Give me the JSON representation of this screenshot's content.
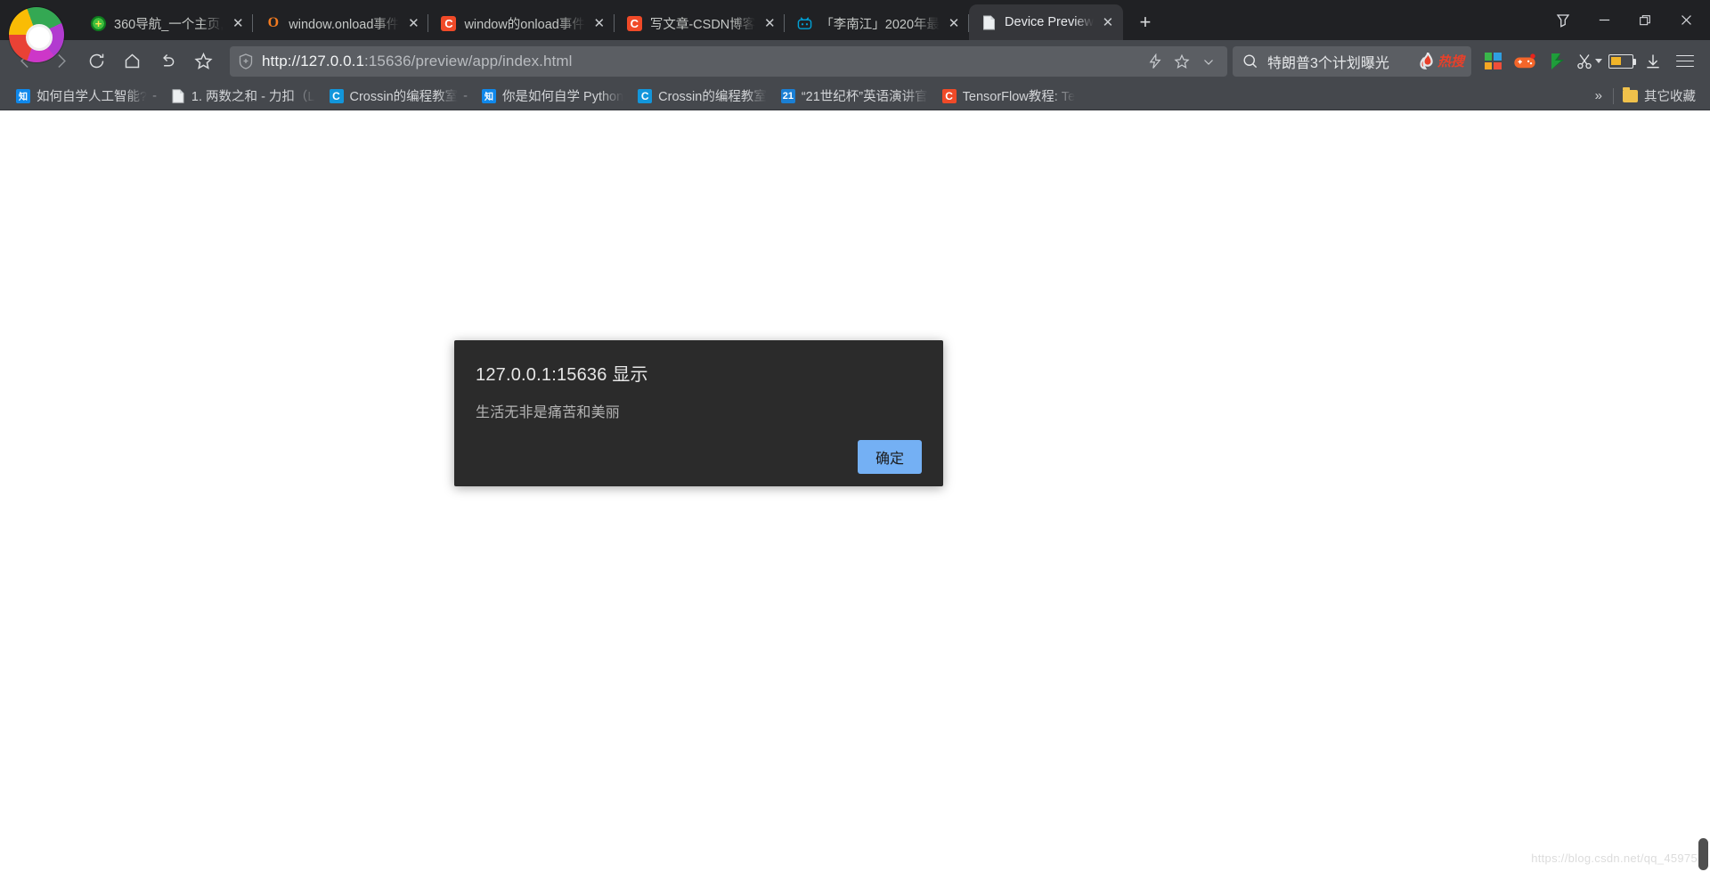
{
  "window": {
    "controls": {
      "tab_search": "tab-search",
      "minimize": "—",
      "maximize": "▢",
      "close": "✕"
    },
    "new_tab_label": "+"
  },
  "tabs": [
    {
      "title": "360导航_一个主页,",
      "favicon": "360-icon",
      "active": false,
      "close": "✕"
    },
    {
      "title": "window.onload事件",
      "favicon": "opera-o-icon",
      "active": false,
      "close": "✕"
    },
    {
      "title": "window的onload事件",
      "favicon": "csdn-icon",
      "active": false,
      "close": "✕"
    },
    {
      "title": "写文章-CSDN博客",
      "favicon": "csdn-icon",
      "active": false,
      "close": "✕"
    },
    {
      "title": "「李南江」2020年最",
      "favicon": "bilibili-icon",
      "active": false,
      "close": "✕"
    },
    {
      "title": "Device Preview",
      "favicon": "page-icon",
      "active": true,
      "close": "✕"
    }
  ],
  "toolbar": {
    "back": "back-arrow-icon",
    "forward": "forward-arrow-icon",
    "reload": "reload-icon",
    "home": "home-icon",
    "undo": "undo-icon",
    "bookmark_star": "star-icon",
    "omnibox": {
      "security_icon": "shield-icon",
      "url_host": "http://127.0.0.1",
      "url_rest": ":15636/preview/app/index.html",
      "url_full": "http://127.0.0.1:15636/preview/app/index.html",
      "flash_icon": "lightning-icon",
      "star_icon": "star-outline-icon",
      "chevron_icon": "chevron-down-icon"
    },
    "search": {
      "icon": "search-icon",
      "query": "特朗普3个计划曝光",
      "badge": "热搜"
    },
    "extensions": [
      {
        "name": "microsoft-grid-icon"
      },
      {
        "name": "gamepad-icon"
      },
      {
        "name": "leaf-icon"
      },
      {
        "name": "scissors-icon"
      },
      {
        "name": "battery-icon"
      },
      {
        "name": "download-icon"
      },
      {
        "name": "menu-icon"
      }
    ]
  },
  "bookmarks": {
    "items": [
      {
        "label": "如何自学人工智能?",
        "favicon": "zhihu-icon",
        "fav_text": "知",
        "suffix": "-"
      },
      {
        "label": "1. 两数之和 - 力扣（L",
        "favicon": "page-icon",
        "fav_text": "",
        "suffix": ""
      },
      {
        "label": "Crossin的编程教室",
        "favicon": "csdn-blue-icon",
        "fav_text": "C",
        "suffix": "-"
      },
      {
        "label": "你是如何自学 Python",
        "favicon": "zhihu-icon",
        "fav_text": "知",
        "suffix": ""
      },
      {
        "label": "Crossin的编程教室",
        "favicon": "csdn-blue-icon",
        "fav_text": "C",
        "suffix": ""
      },
      {
        "label": "“21世纪杯”英语演讲官",
        "favicon": "21-icon",
        "fav_text": "21",
        "suffix": ""
      },
      {
        "label": "TensorFlow教程: Te",
        "favicon": "csdn-icon",
        "fav_text": "C",
        "suffix": ""
      }
    ],
    "overflow": "»",
    "other_bookmarks": {
      "label": "其它收藏",
      "icon": "folder-icon"
    }
  },
  "dialog": {
    "title": "127.0.0.1:15636 显示",
    "message": "生活无非是痛苦和美丽",
    "ok_label": "确定",
    "bg_color": "#2b2b2b",
    "button_color": "#74b0f4"
  },
  "page": {
    "watermark": "https://blog.csdn.net/qq_45975"
  }
}
